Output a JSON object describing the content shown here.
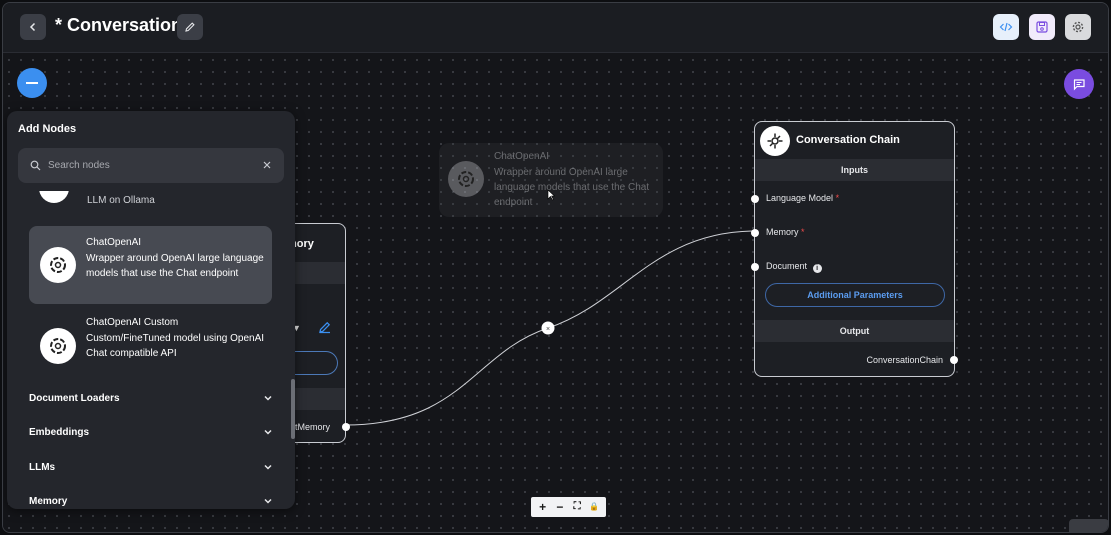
{
  "header": {
    "title": "* Conversation",
    "back_icon": "chevron-left-icon",
    "edit_icon": "pencil-icon",
    "actions": [
      {
        "name": "code-icon",
        "color": "#3b8ff0"
      },
      {
        "name": "save-icon",
        "color": "#7a4ce0"
      },
      {
        "name": "gear-icon",
        "color": "#555"
      }
    ]
  },
  "panel": {
    "title": "Add Nodes",
    "search_placeholder": "Search nodes",
    "cut_item_text": "LLM on Ollama",
    "items": [
      {
        "name": "ChatOpenAI",
        "description": "Wrapper around OpenAI large language models that use the Chat endpoint"
      },
      {
        "name": "ChatOpenAI Custom",
        "description": "Custom/FineTuned model using OpenAI Chat compatible API"
      }
    ],
    "categories": [
      "Document Loaders",
      "Embeddings",
      "LLMs",
      "Memory"
    ]
  },
  "ghost": {
    "name": "ChatOpenAI",
    "description": "Wrapper around OpenAI large language models that use the Chat endpoint"
  },
  "memory_node": {
    "title_fragment": "mory",
    "output_fragment": "atMemory"
  },
  "chain_node": {
    "title": "Conversation Chain",
    "inputs_label": "Inputs",
    "params": [
      {
        "label": "Language Model",
        "required": "*"
      },
      {
        "label": "Memory",
        "required": "*"
      },
      {
        "label": "Document",
        "info": "i"
      }
    ],
    "additional_params": "Additional Parameters",
    "output_label": "Output",
    "output": "ConversationChain"
  },
  "edge": {
    "delete_glyph": "×"
  },
  "zoom": [
    "+",
    "−",
    "⛶",
    "🔒"
  ],
  "colors": {
    "accent_blue": "#3b8ff0",
    "accent_purple": "#7a4ce0",
    "required": "#ef4b4b",
    "link": "#5b9cf0"
  }
}
